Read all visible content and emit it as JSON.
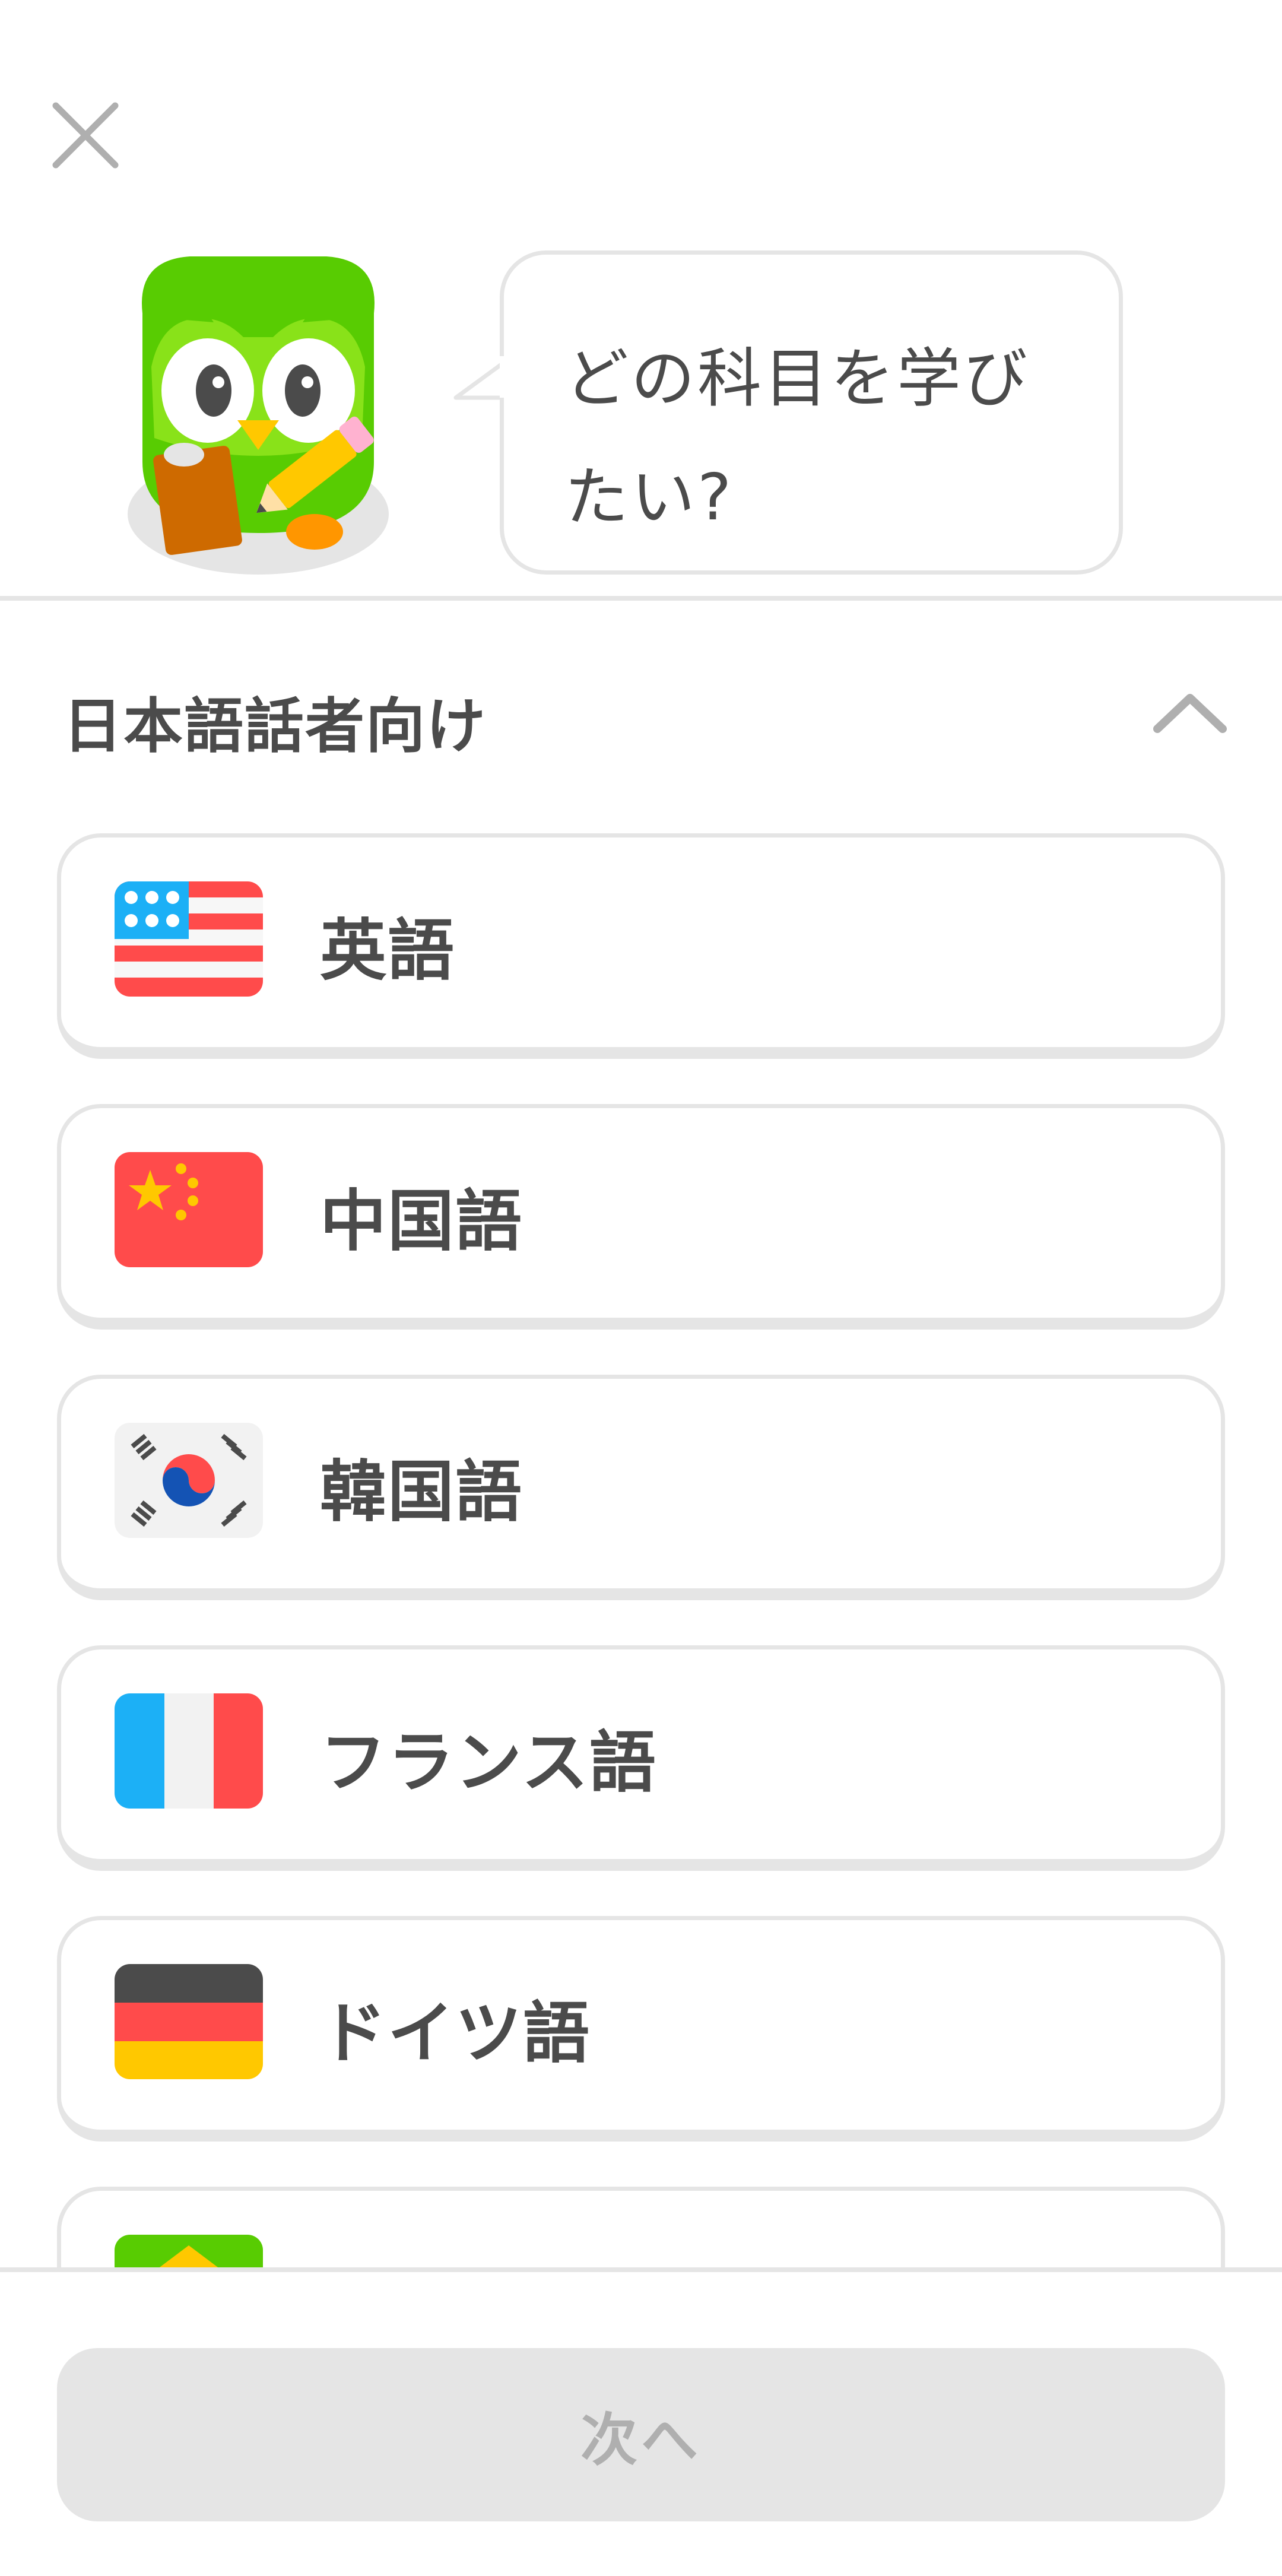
{
  "header": {
    "close_icon": "close-icon",
    "question": "どの科目を学びたい?"
  },
  "section": {
    "title": "日本語話者向け",
    "toggle_icon": "chevron-up-icon"
  },
  "courses": [
    {
      "label": "英語",
      "flag": "us-flag-icon"
    },
    {
      "label": "中国語",
      "flag": "china-flag-icon"
    },
    {
      "label": "韓国語",
      "flag": "korea-flag-icon"
    },
    {
      "label": "フランス語",
      "flag": "france-flag-icon"
    },
    {
      "label": "ドイツ語",
      "flag": "germany-flag-icon"
    },
    {
      "label": "",
      "flag": "brazil-flag-icon"
    }
  ],
  "footer": {
    "next_label": "次へ",
    "next_enabled": false
  },
  "colors": {
    "owl_green": "#58cc02",
    "border": "#e5e5e5",
    "text": "#4b4b4b",
    "disabled_text": "#afafaf"
  }
}
